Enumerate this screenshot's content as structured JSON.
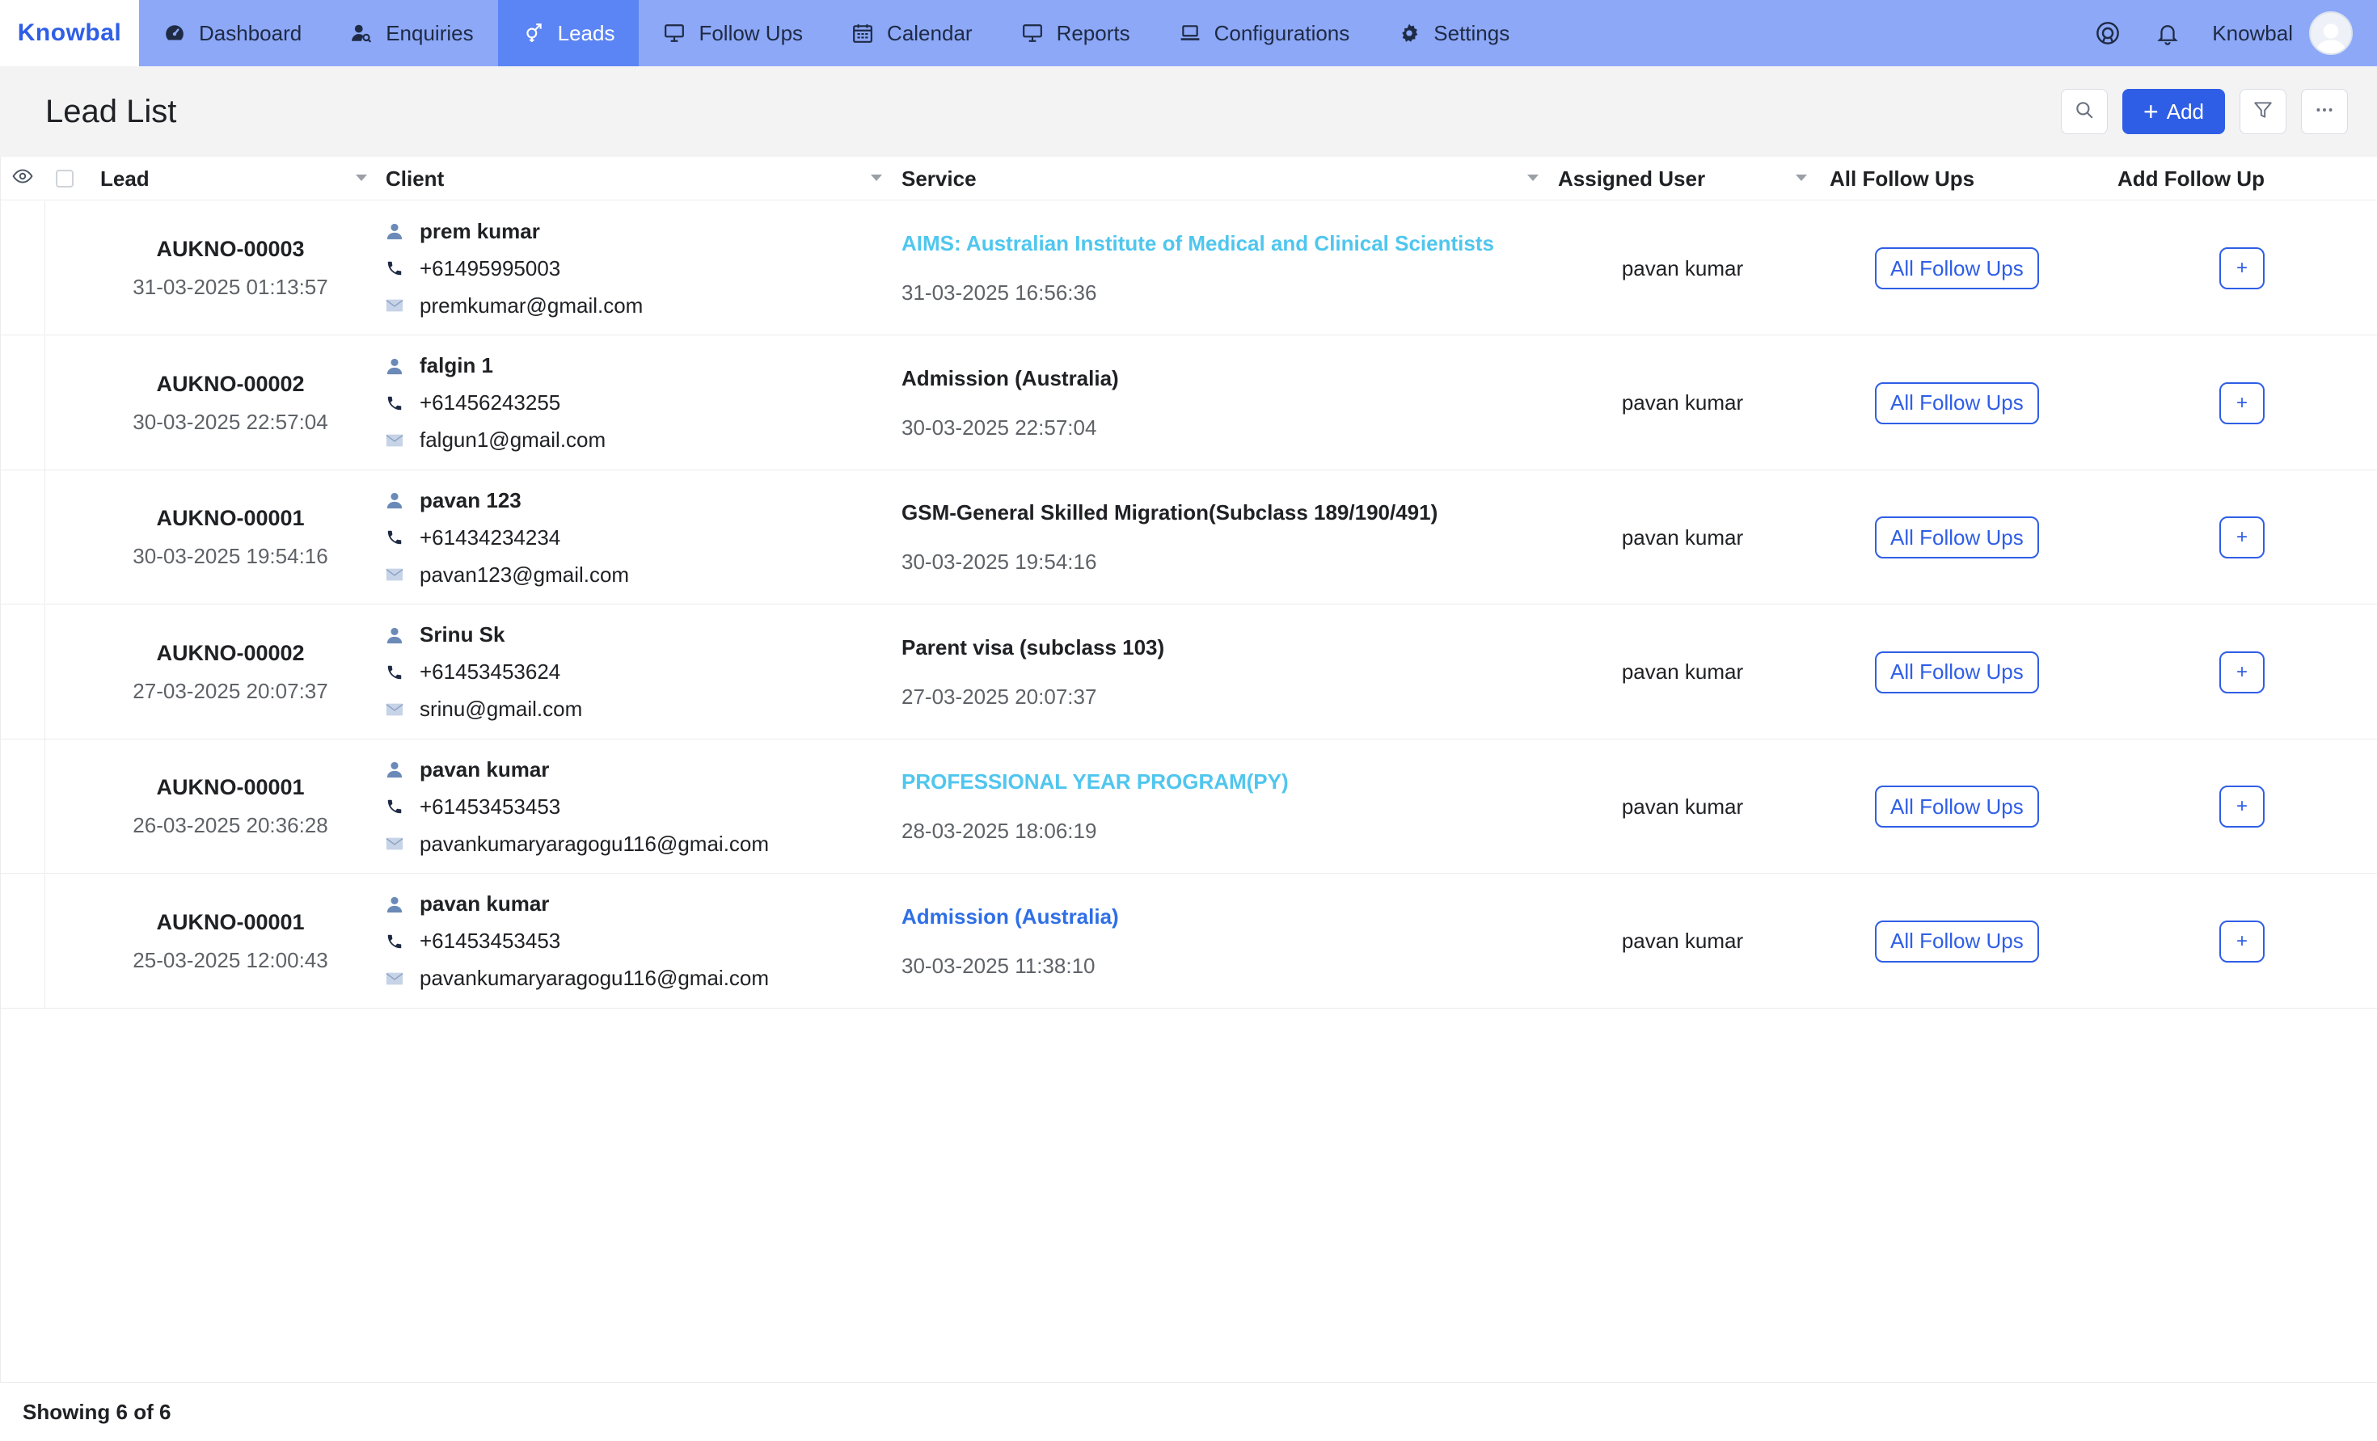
{
  "app": {
    "logo": "Knowbal",
    "brand_color": "#2f5ee6",
    "nav_color": "#8ca8f7",
    "active_nav_color": "#5b84f4"
  },
  "nav": {
    "items": [
      {
        "label": "Dashboard",
        "icon": "dashboard-gauge-icon"
      },
      {
        "label": "Enquiries",
        "icon": "user-search-icon"
      },
      {
        "label": "Leads",
        "icon": "gender-icon",
        "active": true
      },
      {
        "label": "Follow Ups",
        "icon": "monitor-icon"
      },
      {
        "label": "Calendar",
        "icon": "calendar-icon"
      },
      {
        "label": "Reports",
        "icon": "monitor-icon"
      },
      {
        "label": "Configurations",
        "icon": "laptop-icon"
      },
      {
        "label": "Settings",
        "icon": "gear-icon"
      }
    ],
    "user_name": "Knowbal"
  },
  "header": {
    "title": "Lead List",
    "add_label": "Add"
  },
  "table": {
    "columns": {
      "lead": "Lead",
      "client": "Client",
      "service": "Service",
      "assigned": "Assigned User",
      "all_follow_ups": "All Follow Ups",
      "add_follow_up": "Add Follow Up"
    },
    "rows": [
      {
        "lead_id": "AUKNO-00003",
        "lead_date": "31-03-2025 01:13:57",
        "client_name": "prem kumar",
        "client_phone": "+61495995003",
        "client_email": "premkumar@gmail.com",
        "service": "AIMS: Australian Institute of Medical and Clinical Scientists",
        "service_color": "cyan",
        "service_date": "31-03-2025 16:56:36",
        "assigned": "pavan kumar",
        "follow_ups_label": "All Follow Ups",
        "add_label": "+"
      },
      {
        "lead_id": "AUKNO-00002",
        "lead_date": "30-03-2025 22:57:04",
        "client_name": "falgin 1",
        "client_phone": "+61456243255",
        "client_email": "falgun1@gmail.com",
        "service": "Admission (Australia)",
        "service_color": "default",
        "service_date": "30-03-2025 22:57:04",
        "assigned": "pavan kumar",
        "follow_ups_label": "All Follow Ups",
        "add_label": "+"
      },
      {
        "lead_id": "AUKNO-00001",
        "lead_date": "30-03-2025 19:54:16",
        "client_name": "pavan 123",
        "client_phone": "+61434234234",
        "client_email": "pavan123@gmail.com",
        "service": "GSM-General Skilled Migration(Subclass 189/190/491)",
        "service_color": "default",
        "service_date": "30-03-2025 19:54:16",
        "assigned": "pavan kumar",
        "follow_ups_label": "All Follow Ups",
        "add_label": "+"
      },
      {
        "lead_id": "AUKNO-00002",
        "lead_date": "27-03-2025 20:07:37",
        "client_name": "Srinu Sk",
        "client_phone": "+61453453624",
        "client_email": "srinu@gmail.com",
        "service": "Parent visa (subclass 103)",
        "service_color": "default",
        "service_date": "27-03-2025 20:07:37",
        "assigned": "pavan kumar",
        "follow_ups_label": "All Follow Ups",
        "add_label": "+"
      },
      {
        "lead_id": "AUKNO-00001",
        "lead_date": "26-03-2025 20:36:28",
        "client_name": "pavan kumar",
        "client_phone": "+61453453453",
        "client_email": "pavankumaryaragogu116@gmai.com",
        "service": "PROFESSIONAL YEAR PROGRAM(PY)",
        "service_color": "cyan",
        "service_date": "28-03-2025 18:06:19",
        "assigned": "pavan kumar",
        "follow_ups_label": "All Follow Ups",
        "add_label": "+"
      },
      {
        "lead_id": "AUKNO-00001",
        "lead_date": "25-03-2025 12:00:43",
        "client_name": "pavan kumar",
        "client_phone": "+61453453453",
        "client_email": "pavankumaryaragogu116@gmai.com",
        "service": "Admission (Australia)",
        "service_color": "blue",
        "service_date": "30-03-2025 11:38:10",
        "assigned": "pavan kumar",
        "follow_ups_label": "All Follow Ups",
        "add_label": "+"
      }
    ]
  },
  "footer": {
    "status": "Showing 6 of 6"
  }
}
